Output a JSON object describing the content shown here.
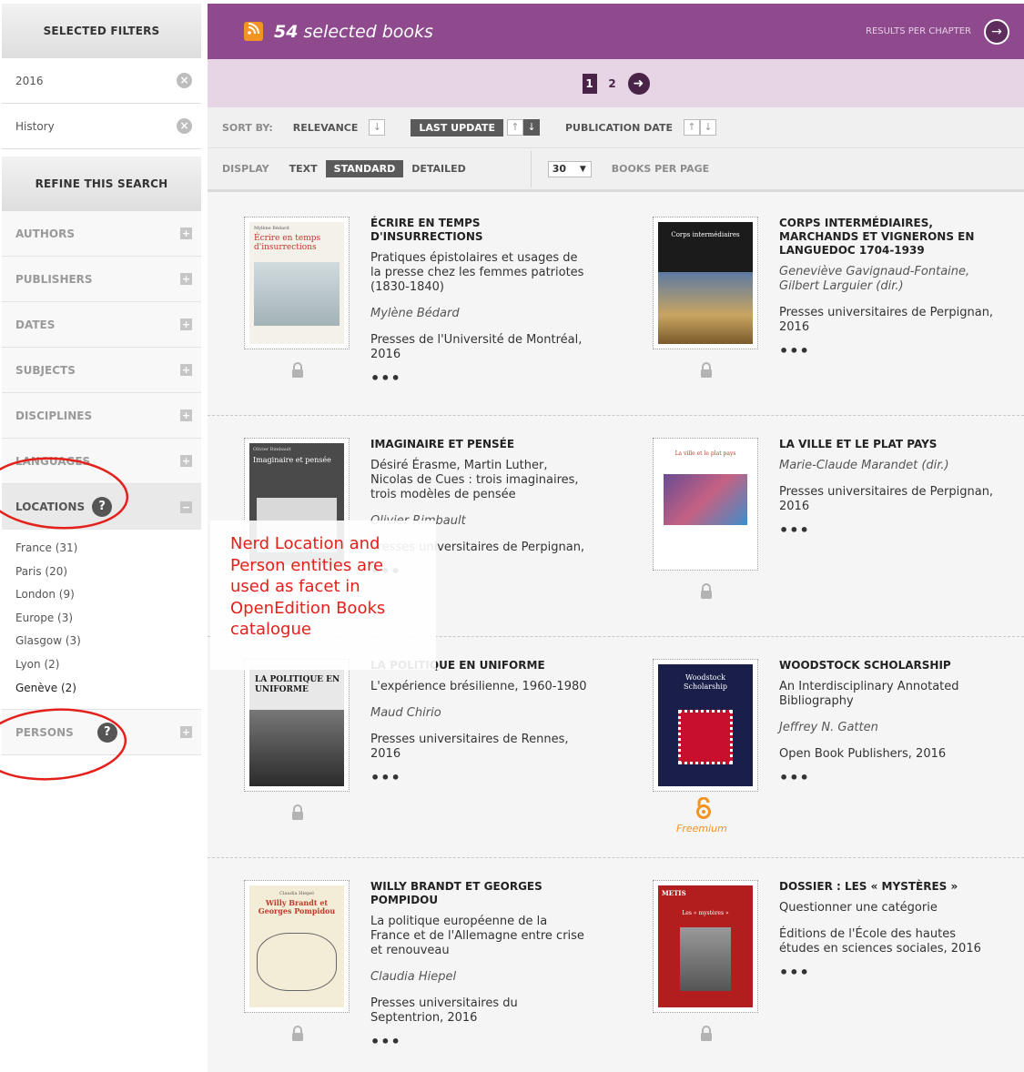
{
  "sidebar": {
    "selected_filters_title": "SELECTED FILTERS",
    "filters": [
      {
        "label": "2016"
      },
      {
        "label": "History"
      }
    ],
    "refine_title": "REFINE THIS SEARCH",
    "facets": [
      {
        "label": "AUTHORS"
      },
      {
        "label": "PUBLISHERS"
      },
      {
        "label": "DATES"
      },
      {
        "label": "SUBJECTS"
      },
      {
        "label": "DISCIPLINES"
      },
      {
        "label": "LANGUAGES"
      }
    ],
    "locations": {
      "label": "LOCATIONS",
      "help": "?",
      "items": [
        "France (31)",
        "Paris (20)",
        "London (9)",
        "Europe (3)",
        "Glasgow (3)",
        "Lyon (2)",
        "Genève (2)"
      ]
    },
    "persons": {
      "label": "PERSONS",
      "help": "?"
    }
  },
  "header": {
    "count": "54",
    "title_suffix": "selected books",
    "results_per_chapter": "RESULTS PER CHAPTER"
  },
  "pager": {
    "current": "1",
    "pages": [
      "2"
    ]
  },
  "sort": {
    "label": "SORT BY:",
    "options": [
      "RELEVANCE",
      "LAST UPDATE",
      "PUBLICATION DATE"
    ]
  },
  "display": {
    "label": "DISPLAY",
    "options": [
      "TEXT",
      "STANDARD",
      "DETAILED"
    ],
    "per_page_value": "30",
    "per_page_label": "BOOKS PER PAGE"
  },
  "books": [
    {
      "title": "ÉCRIRE EN TEMPS D'INSURRECTIONS",
      "subtitle": "Pratiques épistolaires et usages de la presse chez les femmes patriotes (1830-1840)",
      "author": "Mylène Bédard",
      "publisher": "Presses de l'Université de Montréal, 2016",
      "cover": {
        "top": "Mylène Bédard",
        "title": "Écrire en temps d'insurrections",
        "accent": "#c0392b"
      }
    },
    {
      "title": "CORPS INTERMÉDIAIRES, MARCHANDS ET VIGNERONS EN LANGUEDOC 1704-1939",
      "subtitle": "",
      "author": "Geneviève Gavignaud-Fontaine, Gilbert Larguier (dir.)",
      "publisher": "Presses universitaires de Perpignan, 2016",
      "cover": {
        "title": "Corps intermédiaires",
        "accent": "#1b1b1b"
      }
    },
    {
      "title": "IMAGINAIRE ET PENSÉE",
      "subtitle": "Désiré Érasme, Martin Luther, Nicolas de Cues : trois imaginaires, trois modèles de pensée",
      "author": "Olivier Rimbault",
      "publisher": "Presses universitaires de Perpignan,",
      "cover": {
        "top": "Olivier Rimbault",
        "title": "Imaginaire et pensée",
        "accent": "#4a4a4a"
      }
    },
    {
      "title": "LA VILLE ET LE PLAT PAYS",
      "subtitle": "",
      "author": "Marie-Claude Marandet (dir.)",
      "publisher": "Presses universitaires de Perpignan, 2016",
      "cover": {
        "title": "La ville et le plat pays",
        "accent": "#c0392b"
      }
    },
    {
      "title": "LA POLITIQUE EN UNIFORME",
      "subtitle": "L'expérience brésilienne, 1960-1980",
      "author": "Maud Chirio",
      "publisher": "Presses universitaires de Rennes, 2016",
      "cover": {
        "title": "LA POLITIQUE EN UNIFORME",
        "accent": "#2b2b2b"
      }
    },
    {
      "title": "WOODSTOCK SCHOLARSHIP",
      "subtitle": "An Interdisciplinary Annotated Bibliography",
      "author": "Jeffrey N. Gatten",
      "publisher": "Open Book Publishers, 2016",
      "cover": {
        "title": "Woodstock Scholarship",
        "accent": "#1a1f4a"
      },
      "freemium": "Freemium"
    },
    {
      "title": "WILLY BRANDT ET GEORGES POMPIDOU",
      "subtitle": "La politique européenne de la France et de l'Allemagne entre crise et renouveau",
      "author": "Claudia Hiepel",
      "publisher": "Presses universitaires du Septentrion, 2016",
      "cover": {
        "top": "Claudia Hiepel",
        "title": "Willy Brandt et Georges Pompidou",
        "accent": "#c0392b"
      }
    },
    {
      "title": "DOSSIER : LES « MYSTÈRES »",
      "subtitle": "Questionner une catégorie",
      "author": "",
      "publisher": "Éditions de l'École des hautes études en sciences sociales, 2016",
      "cover": {
        "top": "METIS",
        "title": "Les « mystères »",
        "accent": "#b21e1e"
      }
    }
  ],
  "dots": "•••",
  "annotation": {
    "lines": [
      "Nerd Location and",
      "Person entities are",
      "used as facet in",
      "OpenEdition Books",
      "catalogue"
    ],
    "color": "#e4201b"
  },
  "colors": {
    "brand": "#8e4a8d",
    "pager_bg": "#e7d4e4",
    "accent_orange": "#f29322"
  }
}
